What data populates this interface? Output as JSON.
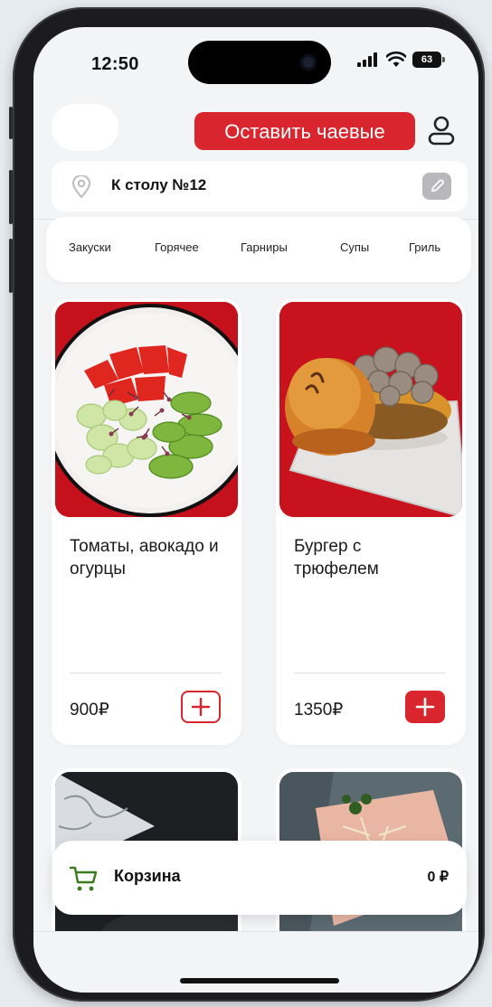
{
  "status": {
    "time": "12:50",
    "battery": "63"
  },
  "header": {
    "tip_button": "Оставить чаевые"
  },
  "location": {
    "text": "К столу №12"
  },
  "categories": [
    "Закуски",
    "Горячее",
    "Гарниры",
    "Супы",
    "Гриль"
  ],
  "products": [
    {
      "name": "Томаты, авокадо и огурцы",
      "price": "900₽",
      "added": false
    },
    {
      "name": "Бургер с трюфелем",
      "price": "1350₽",
      "added": true
    }
  ],
  "cart": {
    "label": "Корзина",
    "total": "0 ₽"
  },
  "colors": {
    "accent": "#d9262e",
    "background": "#f3f4f6"
  }
}
